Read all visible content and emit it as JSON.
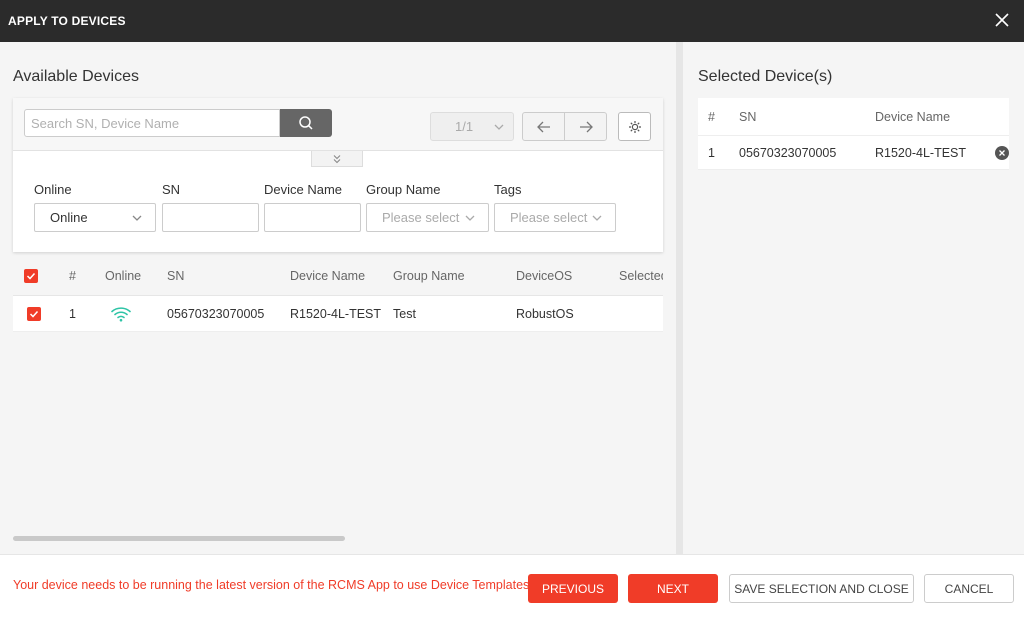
{
  "dialog": {
    "title": "APPLY TO DEVICES"
  },
  "available": {
    "title": "Available Devices",
    "search_placeholder": "Search SN, Device Name",
    "page": "1/1",
    "filters": {
      "online": {
        "label": "Online",
        "value": "Online"
      },
      "sn": {
        "label": "SN",
        "value": ""
      },
      "device_name": {
        "label": "Device Name",
        "value": ""
      },
      "group_name": {
        "label": "Group Name",
        "placeholder": "Please select"
      },
      "tags": {
        "label": "Tags",
        "placeholder": "Please select"
      }
    },
    "columns": [
      "#",
      "Online",
      "SN",
      "Device Name",
      "Group Name",
      "DeviceOS",
      "Selected"
    ],
    "rows": [
      {
        "num": "1",
        "sn": "05670323070005",
        "device_name": "R1520-4L-TEST",
        "group_name": "Test",
        "device_os": "RobustOS",
        "checked": true
      }
    ]
  },
  "selected": {
    "title": "Selected Device(s)",
    "columns": [
      "#",
      "SN",
      "Device Name"
    ],
    "rows": [
      {
        "num": "1",
        "sn": "05670323070005",
        "device_name": "R1520-4L-TEST"
      }
    ]
  },
  "footer": {
    "message": "Your device needs to be running the latest version of the RCMS App to use Device Templates.",
    "previous_label": "PREVIOUS",
    "next_label": "NEXT",
    "save_label": "SAVE SELECTION AND CLOSE",
    "cancel_label": "CANCEL"
  },
  "colors": {
    "header": "#2b2b2b",
    "accent": "#f03c28",
    "online": "#2ec4a6"
  },
  "icons": [
    "close-icon",
    "search-icon",
    "chevron-down-icon",
    "arrow-left-icon",
    "arrow-right-icon",
    "settings-icon",
    "double-chevron-down-icon",
    "checkbox-checked-icon",
    "wifi-icon",
    "remove-circle-icon"
  ]
}
